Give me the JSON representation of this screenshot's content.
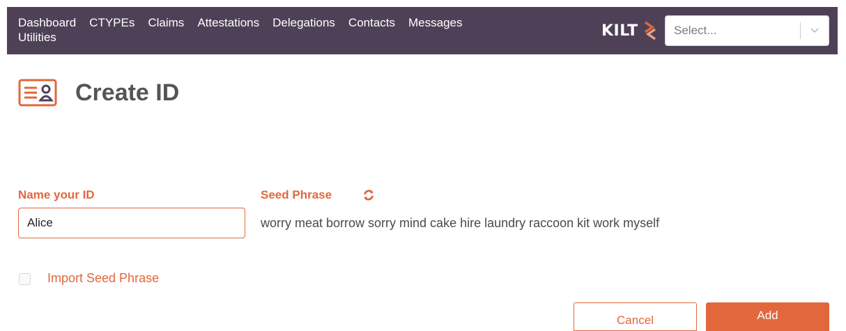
{
  "header": {
    "nav": [
      "Dashboard",
      "CTYPEs",
      "Claims",
      "Attestations",
      "Delegations",
      "Contacts",
      "Messages",
      "Utilities"
    ],
    "brand": "KILT",
    "identity_select": {
      "placeholder": "Select..."
    }
  },
  "page": {
    "title": "Create ID"
  },
  "form": {
    "name_label": "Name your ID",
    "name_value": "Alice",
    "seed_label": "Seed Phrase",
    "seed_phrase": "worry meat borrow sorry mind cake hire laundry raccoon kit work myself",
    "import_label": "Import Seed Phrase",
    "import_checked": false
  },
  "actions": {
    "cancel": "Cancel",
    "add": "Add"
  },
  "colors": {
    "accent": "#e2673b",
    "header_bg": "#4e4157"
  },
  "icons": [
    "id-card-icon",
    "refresh-icon",
    "chevron-down-icon",
    "kilt-logo"
  ]
}
